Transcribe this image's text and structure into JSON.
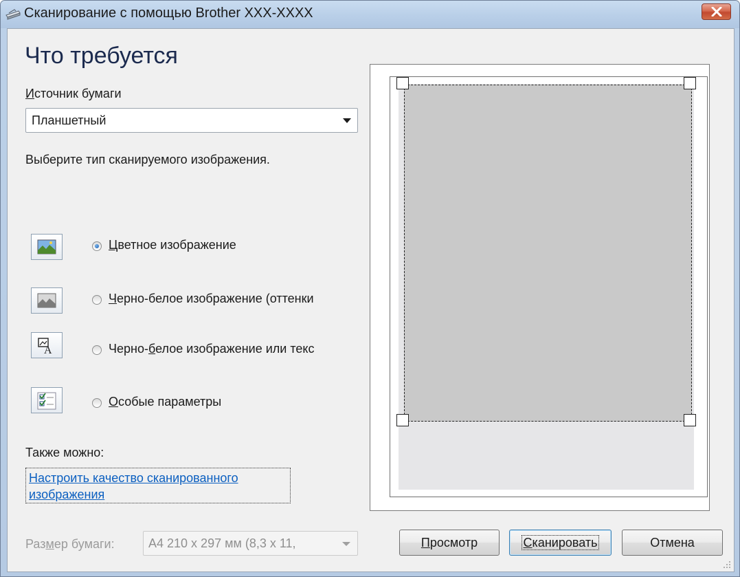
{
  "window": {
    "title": "Сканирование с помощью Brother XXX-XXXX"
  },
  "heading": "Что требуется",
  "paper_source": {
    "label_first": "И",
    "label_rest": "сточник бумаги",
    "value": "Планшетный"
  },
  "image_type_prompt": "Выберите тип сканируемого изображения.",
  "options": [
    {
      "key": "Ц",
      "label": "ветное изображение",
      "checked": true,
      "icon": "color-picture-icon"
    },
    {
      "key": "Ч",
      "label": "ерно-белое изображение (оттенки",
      "checked": false,
      "icon": "grayscale-picture-icon"
    },
    {
      "pre": "Черно-",
      "key": "б",
      "label": "елое изображение или текс",
      "checked": false,
      "icon": "bw-text-icon"
    },
    {
      "key": "О",
      "label": "собые параметры",
      "checked": false,
      "icon": "custom-settings-icon"
    }
  ],
  "also": {
    "label": "Также можно:",
    "link_line1": "Настроить качество сканированного",
    "link_line2": "изображения"
  },
  "paper_size": {
    "label_pre": "Раз",
    "label_key": "м",
    "label_post": "ер бумаги:",
    "value": "A4 210 x 297 мм (8,3 x 11,"
  },
  "buttons": {
    "preview_key": "П",
    "preview_rest": "росмотр",
    "scan_key": "С",
    "scan_rest": "канировать",
    "cancel": "Отмена"
  }
}
